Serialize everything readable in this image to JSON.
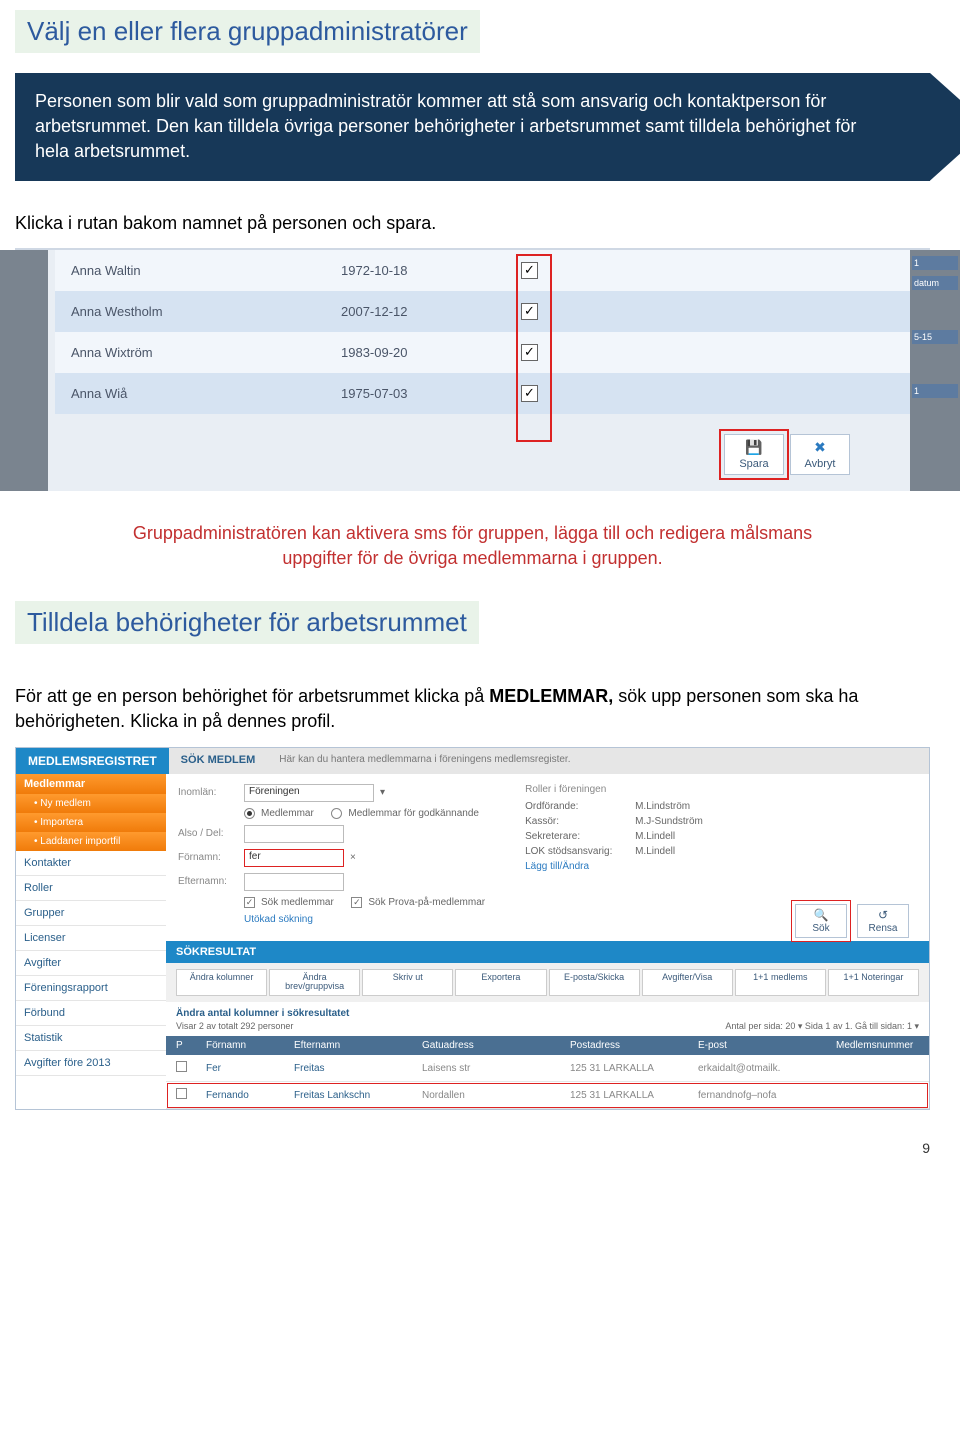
{
  "heading1": "Välj en eller flera gruppadministratörer",
  "callout": "Personen som blir vald som gruppadministratör kommer att stå som ansvarig och kontaktperson för arbetsrummet. Den kan tilldela övriga personer behörigheter i arbetsrummet samt tilldela behörighet för hela arbetsrummet.",
  "body1": "Klicka i rutan bakom namnet på personen och spara.",
  "members": [
    {
      "name": "Anna Waltin",
      "date": "1972-10-18",
      "checked": true,
      "alt": false
    },
    {
      "name": "Anna Westholm",
      "date": "2007-12-12",
      "checked": true,
      "alt": true
    },
    {
      "name": "Anna Wixtröm",
      "date": "1983-09-20",
      "checked": true,
      "alt": false
    },
    {
      "name": "Anna Wiå",
      "date": "1975-07-03",
      "checked": true,
      "alt": true
    }
  ],
  "spara": "Spara",
  "avbryt": "Avbryt",
  "right_chips": {
    "a": "1",
    "b": "datum",
    "c": "5-15",
    "d": "1"
  },
  "red_note": "Gruppadministratören kan aktivera sms för gruppen, lägga till och redigera målsmans uppgifter för de övriga medlemmarna i gruppen.",
  "heading2": "Tilldela behörigheter för arbetsrummet",
  "body2a": "För att ge en person behörighet för arbetsrummet klicka på ",
  "body2b": "MEDLEMMAR,",
  "body2c": " sök upp personen som ska ha behörigheten. Klicka in på dennes profil.",
  "shot2": {
    "title_left": "MEDLEMSREGISTRET",
    "title_mid": "SÖK MEDLEM",
    "title_rest": "Här kan du hantera medlemmarna i föreningens medlemsregister.",
    "sidebar_top": "Medlemmar",
    "sidebar_sub": [
      "Ny medlem",
      "Importera",
      "Laddaner importfil"
    ],
    "sidebar_items": [
      "Kontakter",
      "Roller",
      "Grupper",
      "Licenser",
      "Avgifter",
      "Föreningsrapport",
      "Förbund",
      "Statistik",
      "Avgifter före 2013"
    ],
    "form": {
      "lbl_inomlan": "Inomlän:",
      "val_inomlan": "Föreningen",
      "radio_medlemmar": "Medlemmar",
      "radio_pending": "Medlemmar för godkännande",
      "lbl_also": "Also / Del:",
      "lbl_fornamn": "Förnamn:",
      "val_fornamn": "fer",
      "lbl_efternamn": "Efternamn:",
      "cb_sok": "Sök medlemmar",
      "cb_prova": "Sök Prova-på-medlemmar",
      "link_utokad": "Utökad sökning"
    },
    "roles": {
      "title": "Roller i föreningen",
      "rows": [
        [
          "Ordförande:",
          "M.Lindström"
        ],
        [
          "Kassör:",
          "M.J-Sundström"
        ],
        [
          "Sekreterare:",
          "M.Lindell"
        ],
        [
          "LOK stödsansvarig:",
          "M.Lindell"
        ]
      ],
      "link": "Lägg till/Ändra"
    },
    "sok": "Sök",
    "rensa": "Rensa",
    "sokres": "SÖKRESULTAT",
    "toolbar": [
      "Ändra kolumner",
      "Ändra brev/gruppvisa",
      "Skriv ut",
      "Exportera",
      "E-posta/Skicka",
      "Avgifter/Visa",
      "1+1 medlems",
      "1+1 Noteringar"
    ],
    "mini_note": "Ändra antal kolumner i sökresultatet",
    "mini_paging": "Visar 2 av totalt 292 personer",
    "mini_right": "Antal per sida: 20  ▾    Sida 1 av 1. Gå till sidan: 1  ▾",
    "cols": [
      "P",
      "Förnamn",
      "Efternamn",
      "Gatuadress",
      "Postadress",
      "E-post",
      "Medlemsnummer"
    ],
    "rows": [
      {
        "p": "",
        "fn": "Fer",
        "en": "Freitas",
        "ga": "Laisens str",
        "pa": "125 31 LARKALLA",
        "ep": "erkaidalt@otmailk.",
        "mn": "",
        "red": false
      },
      {
        "p": "",
        "fn": "Fernando",
        "en": "Freitas Lankschn",
        "ga": "Nordallen",
        "pa": "125 31 LARKALLA",
        "ep": "fernandnofg–nofa",
        "mn": "",
        "red": true
      }
    ]
  },
  "page_number": "9"
}
